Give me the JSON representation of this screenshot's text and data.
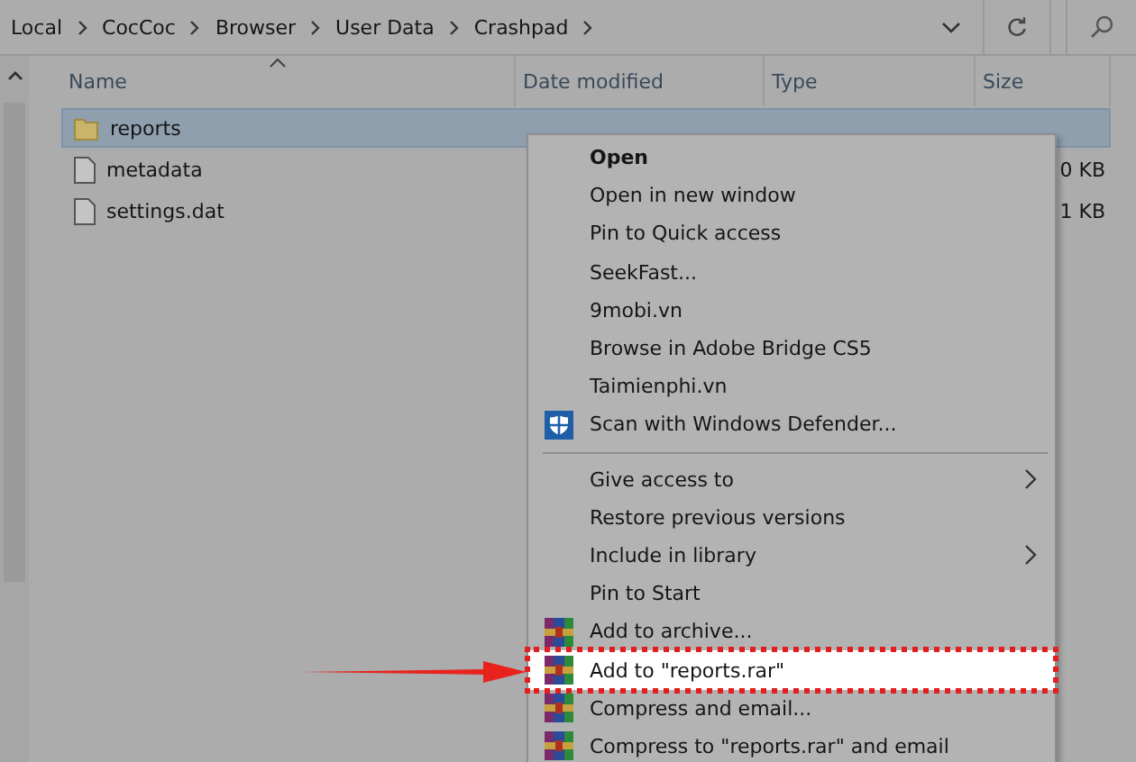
{
  "breadcrumb": [
    "Local",
    "CocCoc",
    "Browser",
    "User Data",
    "Crashpad"
  ],
  "columns": [
    "Name",
    "Date modified",
    "Type",
    "Size"
  ],
  "files": [
    {
      "name": "reports",
      "kind": "folder",
      "selected": true
    },
    {
      "name": "metadata",
      "kind": "file",
      "selected": false,
      "size": "0 KB"
    },
    {
      "name": "settings.dat",
      "kind": "file",
      "selected": false,
      "size": "1 KB"
    }
  ],
  "context_menu": [
    {
      "kind": "item",
      "label": "Open",
      "bold": true,
      "selected": false
    },
    {
      "kind": "item",
      "label": "Open in new window",
      "selected": false
    },
    {
      "kind": "item",
      "label": "Pin to Quick access",
      "selected": false
    },
    {
      "kind": "item",
      "label": "SeekFast...",
      "selected": false
    },
    {
      "kind": "item",
      "label": "9mobi.vn",
      "selected": false
    },
    {
      "kind": "item",
      "label": "Browse in Adobe Bridge CS5",
      "selected": false
    },
    {
      "kind": "item",
      "label": "Taimienphi.vn",
      "selected": false
    },
    {
      "kind": "shield",
      "label": "Scan with Windows Defender...",
      "selected": false
    },
    {
      "kind": "separator"
    },
    {
      "kind": "item",
      "label": "Give access to",
      "submenu": true,
      "selected": false
    },
    {
      "kind": "item",
      "label": "Restore previous versions",
      "selected": false
    },
    {
      "kind": "item",
      "label": "Include in library",
      "submenu": true,
      "selected": false
    },
    {
      "kind": "item",
      "label": "Pin to Start",
      "selected": false
    },
    {
      "kind": "archive",
      "label": "Add to archive...",
      "selected": false
    },
    {
      "kind": "archive",
      "label": "Add to \"reports.rar\"",
      "selected": true
    },
    {
      "kind": "archive",
      "label": "Compress and email...",
      "selected": false
    },
    {
      "kind": "archive",
      "label": "Compress to \"reports.rar\" and email",
      "selected": false
    }
  ]
}
